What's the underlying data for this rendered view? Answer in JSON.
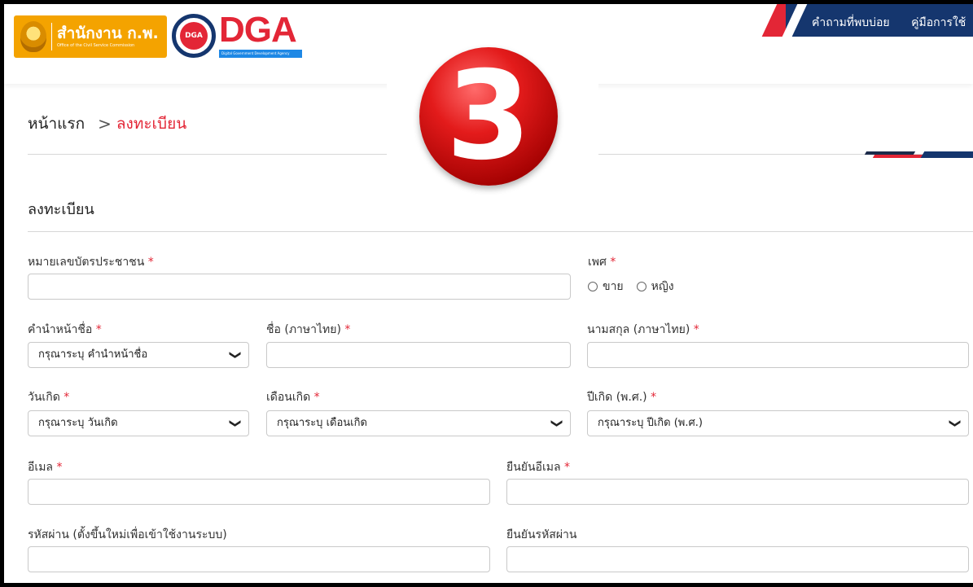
{
  "header": {
    "ocsc_logo_text": "สำนักงาน ก.พ.",
    "ocsc_logo_subtext": "Office of the Civil Service Commission",
    "dga_logo_text": "DGA",
    "dga_logo_subtext": "Digital Government Development Agency",
    "nav": [
      "คำถามที่พบบ่อย",
      "คู่มือการใช้"
    ]
  },
  "step_badge": "3",
  "breadcrumb": {
    "home": "หน้าแรก",
    "separator": ">",
    "current": "ลงทะเบียน"
  },
  "form": {
    "title": "ลงทะเบียน",
    "required_mark": "*",
    "id_card": {
      "label": "หมายเลขบัตรประชาชน",
      "value": ""
    },
    "gender": {
      "label": "เพศ",
      "options": [
        "ขาย",
        "หญิง"
      ]
    },
    "prefix": {
      "label": "คำนำหน้าชื่อ",
      "selected": "กรุณาระบุ คำนำหน้าชื่อ"
    },
    "first_name": {
      "label": "ชื่อ (ภาษาไทย)",
      "value": ""
    },
    "last_name": {
      "label": "นามสกุล (ภาษาไทย)",
      "value": ""
    },
    "birth_day": {
      "label": "วันเกิด",
      "selected": "กรุณาระบุ วันเกิด"
    },
    "birth_month": {
      "label": "เดือนเกิด",
      "selected": "กรุณาระบุ เดือนเกิด"
    },
    "birth_year": {
      "label": "ปีเกิด (พ.ศ.)",
      "selected": "กรุณาระบุ ปีเกิด (พ.ศ.)"
    },
    "email": {
      "label": "อีเมล",
      "value": ""
    },
    "email_confirm": {
      "label": "ยืนยันอีเมล",
      "value": ""
    },
    "password": {
      "label": "รหัสผ่าน (ตั้งขึ้นใหม่เพื่อเข้าใช้งานระบบ)",
      "value": ""
    },
    "password_confirm": {
      "label": "ยืนยันรหัสผ่าน",
      "value": ""
    }
  },
  "colors": {
    "accent_red": "#e32636",
    "navy": "#15366e",
    "ocsc_orange": "#f4a300"
  }
}
